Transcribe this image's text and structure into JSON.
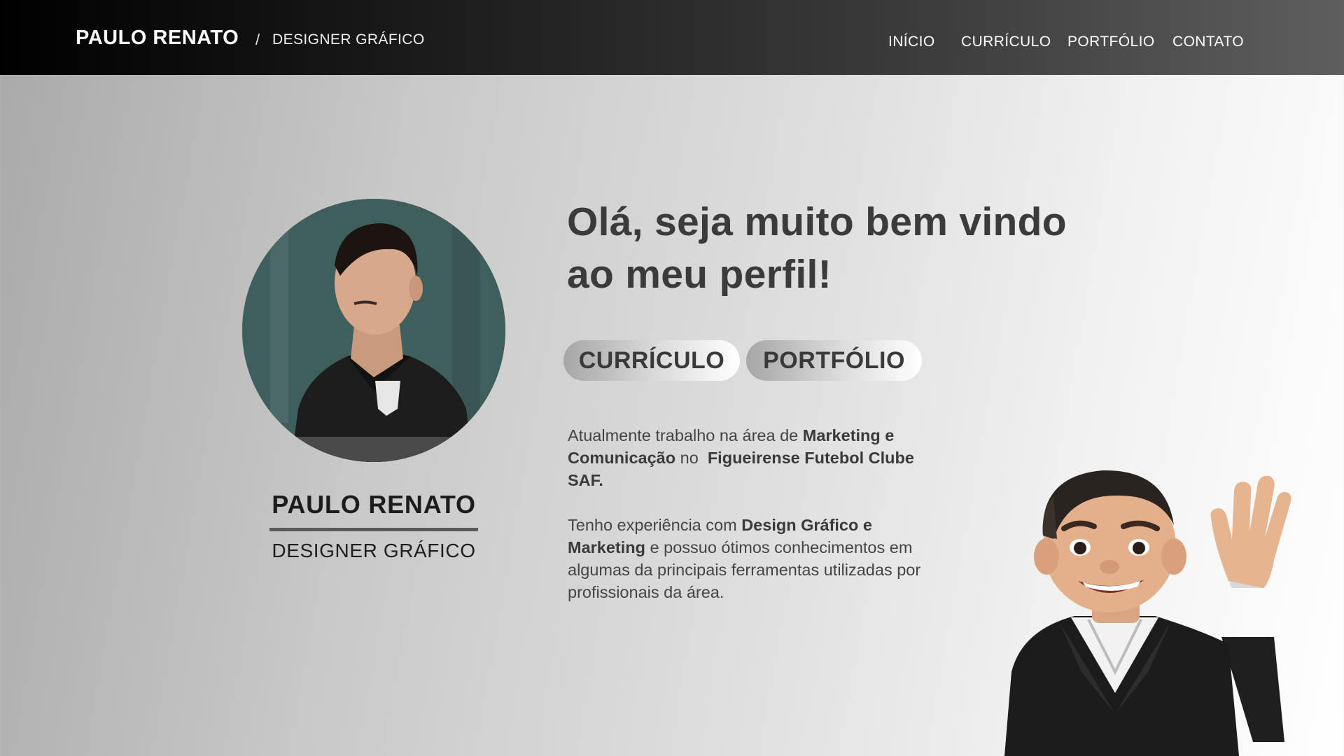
{
  "header": {
    "brand": "PAULO RENATO",
    "separator": "/",
    "subtitle": "DESIGNER GRÁFICO",
    "nav": [
      "INÍCIO",
      "CURRÍCULO",
      "PORTFÓLIO",
      "CONTATO"
    ]
  },
  "profile": {
    "name": "PAULO RENATO",
    "role": "DESIGNER GRÁFICO"
  },
  "hero": {
    "headline_line1": "Olá, seja muito bem vindo",
    "headline_line2": "ao meu perfil!",
    "buttons": [
      "CURRÍCULO",
      "PORTFÓLIO"
    ]
  },
  "about": {
    "p1": {
      "t1": "Atualmente trabalho na área de ",
      "b1": "Marketing e Comunicação",
      "t2": " no  ",
      "b2": "Figueirense Futebol Clube SAF."
    },
    "p2": {
      "t1": "Tenho experiência com ",
      "b1": "Design Gráfico e Marketing",
      "t2": " e possuo ótimos conhecimentos em algumas da principais ferramentas utilizadas por profissionais da área."
    }
  },
  "colors": {
    "header_start": "#000000",
    "header_end": "#5e5e5e",
    "headline": "#3b3b3b",
    "text": "#444444"
  },
  "icons": [
    "profile-photo",
    "memoji-avatar-waving"
  ]
}
